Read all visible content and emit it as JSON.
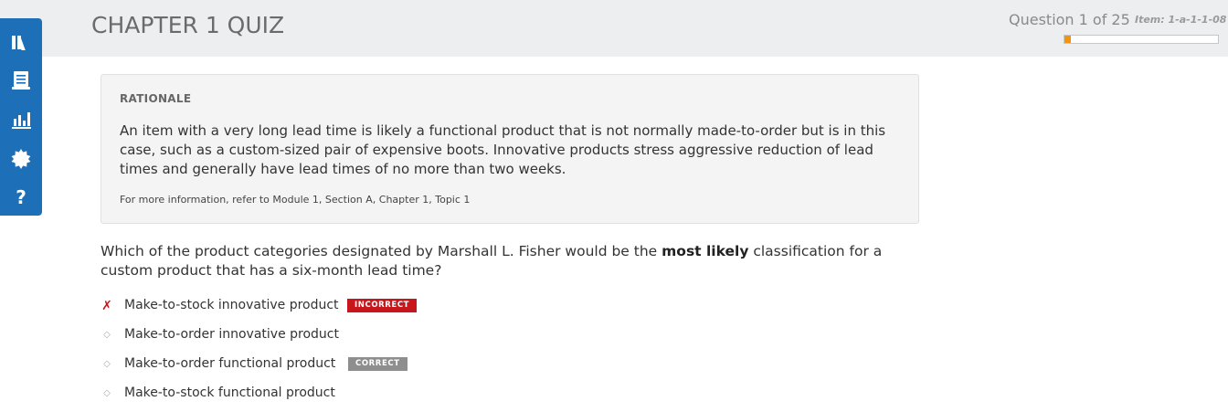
{
  "header": {
    "title": "CHAPTER 1 QUIZ",
    "question_counter": "Question 1 of 25",
    "item_id": "Item: 1-a-1-1-08",
    "progress_fraction": 0.04
  },
  "sidebar": {
    "items": [
      {
        "icon": "books-icon"
      },
      {
        "icon": "notebook-icon"
      },
      {
        "icon": "bar-chart-icon"
      },
      {
        "icon": "settings-badge-icon"
      },
      {
        "icon": "help-icon",
        "glyph": "?"
      }
    ]
  },
  "rationale": {
    "heading": "RATIONALE",
    "body": "An item with a very long lead time is likely a functional product that is not normally made-to-order but is in this case, such as a custom-sized pair of expensive boots. Innovative products stress aggressive reduction of lead times and generally have lead times of no more than two weeks.",
    "reference": "For more information, refer to Module 1, Section A, Chapter 1, Topic 1"
  },
  "question": {
    "prefix": "Which of the product categories designated by Marshall L. Fisher would be the ",
    "emphasis": "most likely",
    "suffix": " classification for a custom product that has a six-month lead time?"
  },
  "answers": [
    {
      "label": "Make-to-stock innovative product",
      "marker": "✗",
      "badge": "INCORRECT",
      "status": "incorrect"
    },
    {
      "label": "Make-to-order innovative product",
      "marker": "◇",
      "badge": "",
      "status": "none"
    },
    {
      "label": "Make-to-order functional product",
      "marker": "◇",
      "badge": "CORRECT",
      "status": "correct"
    },
    {
      "label": "Make-to-stock functional product",
      "marker": "◇",
      "badge": "",
      "status": "none"
    }
  ],
  "colors": {
    "sidebar": "#1d6fb8",
    "progress": "#f29312",
    "incorrect": "#c8161d",
    "correct_badge": "#8e8e8e"
  }
}
